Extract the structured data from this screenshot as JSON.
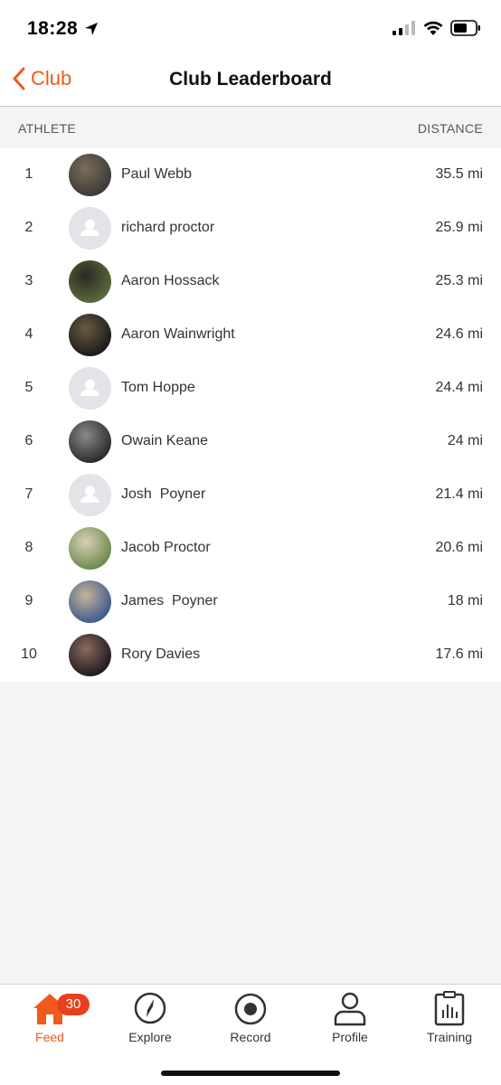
{
  "status_bar": {
    "time": "18:28"
  },
  "nav": {
    "back_label": "Club",
    "title": "Club Leaderboard"
  },
  "columns": {
    "athlete": "ATHLETE",
    "distance": "DISTANCE"
  },
  "leaderboard": [
    {
      "rank": "1",
      "name": "Paul Webb",
      "distance": "35.5 mi",
      "avatar": "photo"
    },
    {
      "rank": "2",
      "name": "richard proctor",
      "distance": "25.9 mi",
      "avatar": "placeholder"
    },
    {
      "rank": "3",
      "name": "Aaron Hossack",
      "distance": "25.3 mi",
      "avatar": "photo"
    },
    {
      "rank": "4",
      "name": "Aaron Wainwright",
      "distance": "24.6 mi",
      "avatar": "photo"
    },
    {
      "rank": "5",
      "name": "Tom Hoppe",
      "distance": "24.4 mi",
      "avatar": "placeholder"
    },
    {
      "rank": "6",
      "name": "Owain Keane",
      "distance": "24 mi",
      "avatar": "photo"
    },
    {
      "rank": "7",
      "name": "Josh  Poyner",
      "distance": "21.4 mi",
      "avatar": "placeholder"
    },
    {
      "rank": "8",
      "name": "Jacob Proctor",
      "distance": "20.6 mi",
      "avatar": "photo"
    },
    {
      "rank": "9",
      "name": "James  Poyner",
      "distance": "18 mi",
      "avatar": "photo"
    },
    {
      "rank": "10",
      "name": "Rory Davies",
      "distance": "17.6 mi",
      "avatar": "photo"
    }
  ],
  "tabs": [
    {
      "label": "Feed",
      "icon": "home-icon",
      "active": true,
      "badge": "30"
    },
    {
      "label": "Explore",
      "icon": "compass-icon",
      "active": false
    },
    {
      "label": "Record",
      "icon": "record-icon",
      "active": false
    },
    {
      "label": "Profile",
      "icon": "profile-icon",
      "active": false
    },
    {
      "label": "Training",
      "icon": "training-icon",
      "active": false
    }
  ],
  "colors": {
    "accent": "#f05a1a",
    "badge": "#e8401c",
    "placeholder_avatar": "#e3e3e8"
  }
}
